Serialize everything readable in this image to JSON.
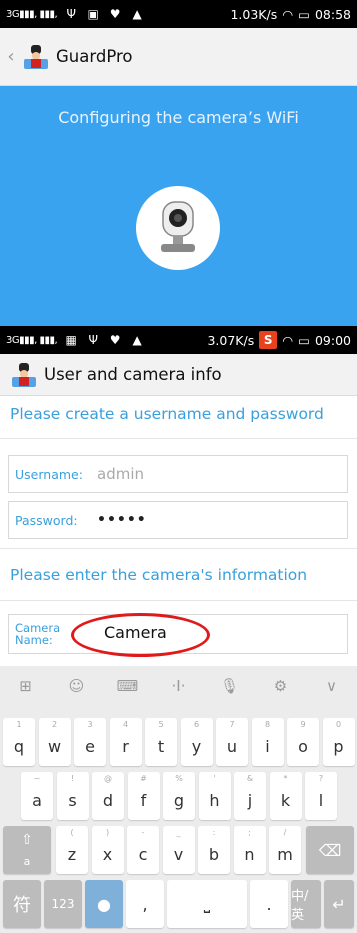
{
  "status1": {
    "speed": "1.03K/s",
    "time": "08:58"
  },
  "status2": {
    "speed": "3.07K/s",
    "time": "09:00"
  },
  "appbar1": {
    "title": "GuardPro"
  },
  "config": {
    "heading": "Configuring the camera’s WiFi"
  },
  "appbar2": {
    "title": "User and camera info"
  },
  "form": {
    "create_heading": "Please create a username and password",
    "username_label": "Username:",
    "username_value": "admin",
    "password_label": "Password:",
    "password_value": "•••••",
    "camera_heading": "Please enter the camera's information",
    "camera_name_label_1": "Camera",
    "camera_name_label_2": "Name:",
    "camera_name_value": "Camera"
  },
  "keyboard": {
    "toolbar": [
      "⊞",
      "☺",
      "⌨",
      "·I·",
      "🎙",
      "⚙",
      "∨"
    ],
    "row1": [
      {
        "k": "q",
        "s": "1"
      },
      {
        "k": "w",
        "s": "2"
      },
      {
        "k": "e",
        "s": "3"
      },
      {
        "k": "r",
        "s": "4"
      },
      {
        "k": "t",
        "s": "5"
      },
      {
        "k": "y",
        "s": "6"
      },
      {
        "k": "u",
        "s": "7"
      },
      {
        "k": "i",
        "s": "8"
      },
      {
        "k": "o",
        "s": "9"
      },
      {
        "k": "p",
        "s": "0"
      }
    ],
    "row2": [
      {
        "k": "a",
        "s": "~"
      },
      {
        "k": "s",
        "s": "!"
      },
      {
        "k": "d",
        "s": "@"
      },
      {
        "k": "f",
        "s": "#"
      },
      {
        "k": "g",
        "s": "%"
      },
      {
        "k": "h",
        "s": "'"
      },
      {
        "k": "j",
        "s": "&"
      },
      {
        "k": "k",
        "s": "*"
      },
      {
        "k": "l",
        "s": "?"
      }
    ],
    "row3": [
      {
        "k": "z",
        "s": "("
      },
      {
        "k": "x",
        "s": ")"
      },
      {
        "k": "c",
        "s": "-"
      },
      {
        "k": "v",
        "s": "_"
      },
      {
        "k": "b",
        "s": ":"
      },
      {
        "k": "n",
        "s": ";"
      },
      {
        "k": "m",
        "s": "/"
      }
    ],
    "shift_sub": "a",
    "fu_key": "符",
    "num_key": "123",
    "comma_key": ",",
    "period_key": ".",
    "lang_key": "中/英"
  }
}
